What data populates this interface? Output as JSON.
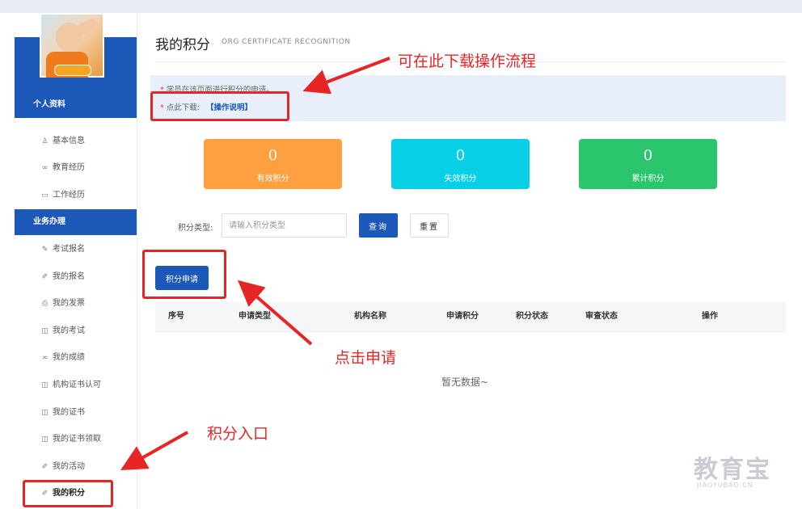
{
  "sidebar": {
    "section_profile": "个人资料",
    "profile_items": [
      {
        "label": "基本信息",
        "icon": "user-icon"
      },
      {
        "label": "教育经历",
        "icon": "glasses-icon"
      },
      {
        "label": "工作经历",
        "icon": "briefcase-icon"
      }
    ],
    "section_business": "业务办理",
    "business_items": [
      {
        "label": "考试报名",
        "icon": "pencil-icon"
      },
      {
        "label": "我的报名",
        "icon": "edit-icon"
      },
      {
        "label": "我的发票",
        "icon": "printer-icon"
      },
      {
        "label": "我的考试",
        "icon": "book-icon"
      },
      {
        "label": "我的成绩",
        "icon": "glasses-icon"
      },
      {
        "label": "机构证书认可",
        "icon": "book-icon"
      },
      {
        "label": "我的证书",
        "icon": "book-icon"
      },
      {
        "label": "我的证书领取",
        "icon": "book-icon"
      },
      {
        "label": "我的活动",
        "icon": "edit-icon"
      },
      {
        "label": "我的积分",
        "icon": "edit-icon",
        "active": true
      }
    ]
  },
  "header": {
    "title": "我的积分",
    "subtitle": "ORG CERTIFICATE RECOGNITION"
  },
  "notice": {
    "line1": "学员在该页面进行积分的申请。",
    "line2_prefix": "点此下载:",
    "download_link": "【操作说明】"
  },
  "stats": [
    {
      "value": "0",
      "label": "有效积分",
      "color": "#ffa040"
    },
    {
      "value": "0",
      "label": "失效积分",
      "color": "#06cfe6"
    },
    {
      "value": "0",
      "label": "累计积分",
      "color": "#2ac56c"
    }
  ],
  "filter": {
    "label": "积分类型:",
    "placeholder": "请输入积分类型",
    "query_label": "查询",
    "reset_label": "重置"
  },
  "apply_button": "积分申请",
  "table": {
    "headers": [
      "序号",
      "申请类型",
      "机构名称",
      "申请积分",
      "积分状态",
      "审查状态",
      "操作"
    ],
    "empty_text": "暂无数据~"
  },
  "annotations": {
    "download_hint": "可在此下载操作流程",
    "apply_hint": "点击申请",
    "entry_hint": "积分入口"
  },
  "watermark": {
    "main": "教育宝",
    "url": "JIAOYUBAO.CN"
  },
  "colors": {
    "primary": "#1b58b8",
    "annotation": "#e82525"
  }
}
